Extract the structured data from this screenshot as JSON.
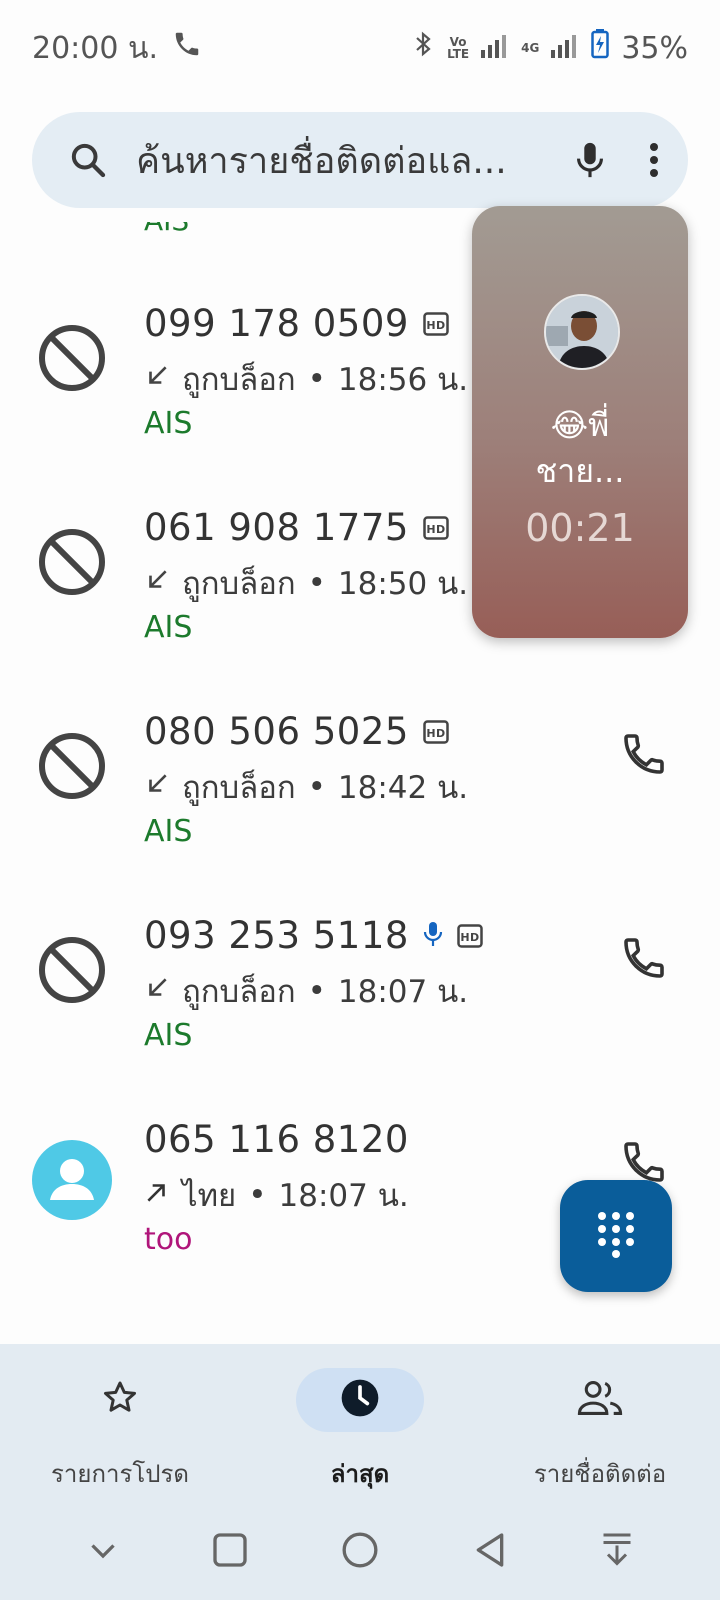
{
  "status_bar": {
    "time": "20:00 น.",
    "battery": "35%",
    "volte_top": "Vo",
    "volte_bottom": "LTE",
    "network": "4G"
  },
  "search": {
    "placeholder": "ค้นหารายชื่อติดต่อแล..."
  },
  "partial_carrier": "AIS",
  "calls": [
    {
      "number": "099 178 0509",
      "status": "ถูกบล็อก",
      "time": "18:56 น.",
      "carrier": "AIS",
      "blocked": true,
      "hd": true,
      "mic": false,
      "direction": "incoming"
    },
    {
      "number": "061 908 1775",
      "status": "ถูกบล็อก",
      "time": "18:50 น.",
      "carrier": "AIS",
      "blocked": true,
      "hd": true,
      "mic": false,
      "direction": "incoming"
    },
    {
      "number": "080 506 5025",
      "status": "ถูกบล็อก",
      "time": "18:42 น.",
      "carrier": "AIS",
      "blocked": true,
      "hd": true,
      "mic": false,
      "direction": "incoming"
    },
    {
      "number": "093 253 5118",
      "status": "ถูกบล็อก",
      "time": "18:07 น.",
      "carrier": "AIS",
      "blocked": true,
      "hd": true,
      "mic": true,
      "direction": "incoming"
    },
    {
      "number": "065 116 8120",
      "status": "ไทย",
      "time": "18:07 น.",
      "carrier": "too",
      "blocked": false,
      "hd": false,
      "mic": false,
      "direction": "outgoing"
    }
  ],
  "separator": "•",
  "pip": {
    "name_line1": "😂พี่",
    "name_line2": "ชาย...",
    "timer": "00:21"
  },
  "bottom_nav": {
    "favorites": "รายการโปรด",
    "recents": "ล่าสุด",
    "contacts": "รายชื่อติดต่อ"
  },
  "colors": {
    "accent": "#0a5d9a",
    "carrier_green": "#1c7a2c",
    "carrier_magenta": "#b0157a",
    "avatar_cyan": "#4fc9e6"
  }
}
